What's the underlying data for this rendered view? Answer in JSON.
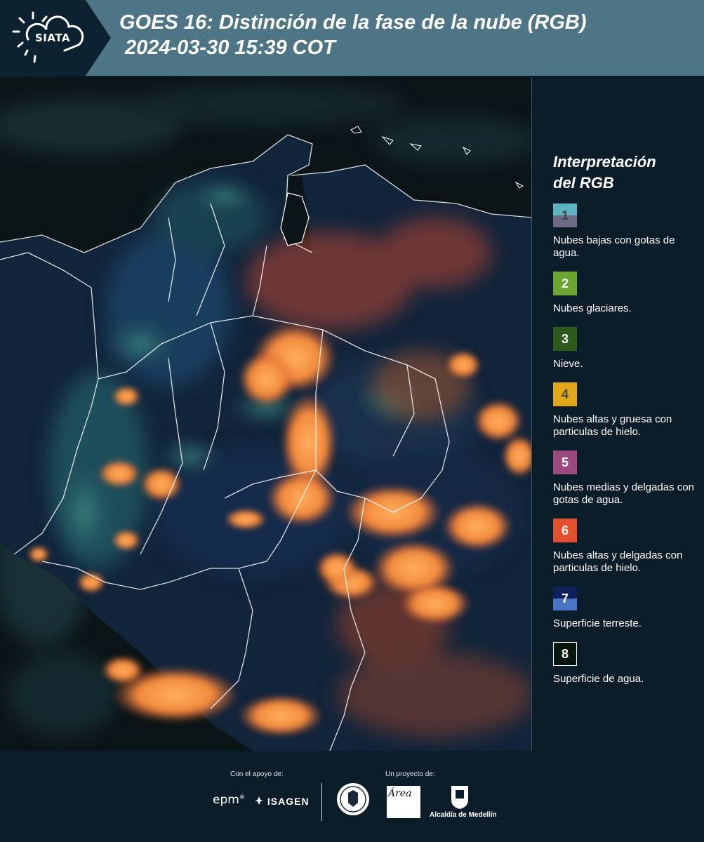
{
  "header": {
    "logo": "SIATA",
    "title": "GOES 16: Distinción de la fase de la nube (RGB)",
    "subtitle": "2024-03-30 15:39 COT"
  },
  "legend": {
    "title": "Interpretación del RGB",
    "items": [
      {
        "num": "1",
        "label": "Nubes bajas con gotas de agua.",
        "color_top": "#5db3c2",
        "color_bottom": "#6e6a86",
        "num_color": "#444444"
      },
      {
        "num": "2",
        "label": "Nubes glaciares.",
        "color_top": "#6aa52f",
        "color_bottom": "#6aa52f",
        "num_color": "#ffffff"
      },
      {
        "num": "3",
        "label": "Nieve.",
        "color_top": "#2e5a1e",
        "color_bottom": "#2e5a1e",
        "num_color": "#ffffff"
      },
      {
        "num": "4",
        "label": "Nubes altas y gruesa con particulas de hielo.",
        "color_top": "#e0a61c",
        "color_bottom": "#e0a61c",
        "num_color": "#444444"
      },
      {
        "num": "5",
        "label": "Nubes medias y delgadas con gotas de agua.",
        "color_top": "#9a4a7f",
        "color_bottom": "#9a4a7f",
        "num_color": "#ffffff"
      },
      {
        "num": "6",
        "label": "Nubes altas y delgadas con particulas de hielo.",
        "color_top": "#e2502e",
        "color_bottom": "#e2502e",
        "num_color": "#ffffff"
      },
      {
        "num": "7",
        "label": "Superficie terreste.",
        "color_top": "#0f1f5e",
        "color_bottom": "#4a74c6",
        "num_color": "#ffffff"
      },
      {
        "num": "8",
        "label": "Superficie de agua.",
        "color_top": "#06160c",
        "color_bottom": "#06160c",
        "num_color": "#ffffff"
      }
    ]
  },
  "footer": {
    "support_label": "Con el apoyo de:",
    "project_label": "Un proyecto de:",
    "epm": "epm",
    "isagen": "ISAGEN",
    "amva": "Área",
    "alcaldia": "Alcaldía de Medellín"
  }
}
